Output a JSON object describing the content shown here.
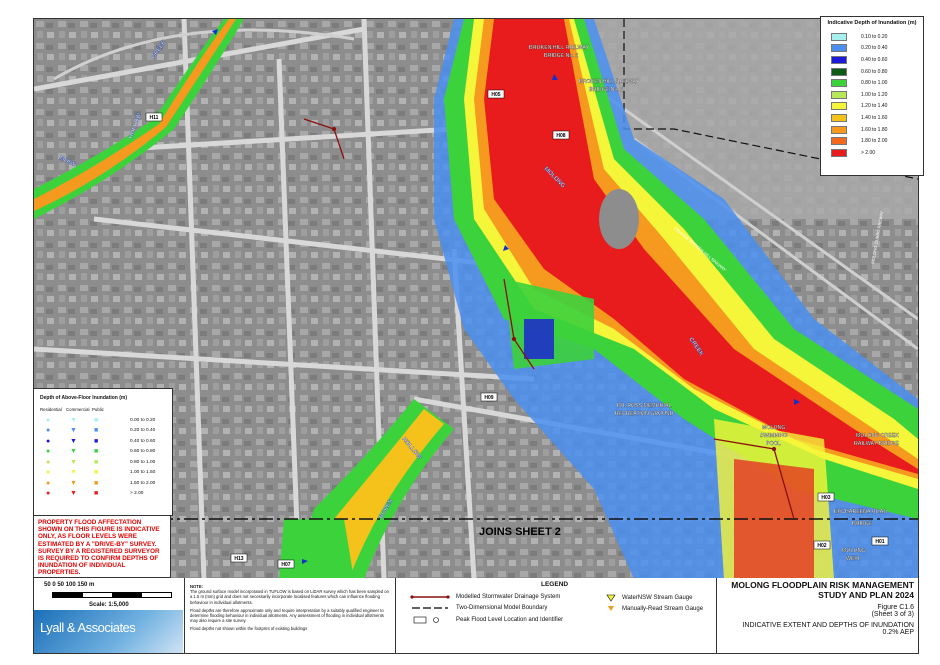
{
  "map": {
    "labels": {
      "broken_hill_2": "BROKEN HILL RAILWAY",
      "broken_hill_2b": "BRIDGE No. 2",
      "broken_hill_1": "BROKEN HILL RAILWAY",
      "broken_hill_1b": "BRIDGE No. 1",
      "molong_creek_n": "MOLONG",
      "creek_label": "CREEK",
      "creek_nw": "CREEK",
      "hollow_nw": "HOLLOW",
      "moss": "MOSS",
      "hollow_s": "HOLLOW",
      "bores": "BORES",
      "ross": "DR. ROSS MEMORIAL",
      "ross2": "RECREATION GROUND",
      "pool1": "MOLONG",
      "pool2": "SWIMMING",
      "pool3": "POOL",
      "mcr1": "MOLONG CREEK",
      "mcr2": "RAILWAY BRIDGE",
      "euch": "EUCHAREENA ROAD",
      "bridge": "BRIDGE",
      "weir1": "MOLONG",
      "weir2": "WEIR",
      "joins": "JOINS SHEET 2",
      "orange_rail": "ORANGE BROKEN HILL RAILWAY",
      "dubbo_rail": "MOLONG DUBBO RAILWAY",
      "h11": "H11",
      "h13": "H13",
      "h05": "H05",
      "h09": "H09",
      "h03": "H03",
      "h07": "H07",
      "h01": "H01",
      "h02": "H02",
      "h08": "H08"
    }
  },
  "depth_legend": {
    "title": "Indicative Depth of Inundation (m)",
    "rows": [
      {
        "label": "0.10 to 0.20",
        "color": "#a6f0f0"
      },
      {
        "label": "0.20 to 0.40",
        "color": "#4a8ff0"
      },
      {
        "label": "0.40 to 0.60",
        "color": "#1a1ad8"
      },
      {
        "label": "0.60 to 0.80",
        "color": "#0f5a14"
      },
      {
        "label": "0.80 to 1.00",
        "color": "#3cd23c"
      },
      {
        "label": "1.00 to 1.20",
        "color": "#b8e85a"
      },
      {
        "label": "1.20 to 1.40",
        "color": "#f5f53a"
      },
      {
        "label": "1.40 to 1.60",
        "color": "#f5c21c"
      },
      {
        "label": "1.60 to 1.80",
        "color": "#f59a1e"
      },
      {
        "label": "1.80 to 2.00",
        "color": "#f26a20"
      },
      {
        "label": "> 2.00",
        "color": "#e81c1c"
      }
    ]
  },
  "floor_legend": {
    "title": "Depth of Above-Floor Inundation (m)",
    "headers": [
      "Residential",
      "Commercial",
      "Public"
    ],
    "rows": [
      {
        "label": "0.00 to 0.20",
        "color": "#a6f0f0"
      },
      {
        "label": "0.20 to 0.40",
        "color": "#4a8ff0"
      },
      {
        "label": "0.40 to 0.60",
        "color": "#1a1ad8"
      },
      {
        "label": "0.60 to 0.80",
        "color": "#3cd23c"
      },
      {
        "label": "0.80 to 1.00",
        "color": "#b8e85a"
      },
      {
        "label": "1.00 to 1.50",
        "color": "#f5f53a"
      },
      {
        "label": "1.50 to 2.00",
        "color": "#f59a1e"
      },
      {
        "label": "> 2.00",
        "color": "#e81c1c"
      }
    ]
  },
  "warning": "PROPERTY FLOOD AFFECTATION SHOWN ON THIS FIGURE IS INDICATIVE ONLY, AS FLOOR LEVELS WERE ESTIMATED BY A \"DRIVE-BY\" SURVEY. SURVEY BY A REGISTERED SURVEYOR IS REQUIRED TO CONFIRM DEPTHS OF INUNDATION OF INDIVIDUAL PROPERTIES.",
  "scale": {
    "ticks": "50    0    50    100    150 m",
    "caption": "Scale: 1:5,000",
    "logo": "Lyall & Associates"
  },
  "note": {
    "title": "NOTE:",
    "p1": "The ground surface model incorporated in TUFLOW is based on LiDAR survey which has been sampled on a 1.5 m (mm) grid and does not necessarily incorporate localised features which can influence flooding behaviour in individual allotments.",
    "p2": "Flood depths are therefore approximate only and require interpretation by a suitably qualified engineer to determine flooding behaviour in individual allotments. Any assessment of flooding in individual allotments may also require a site survey.",
    "p3": "Flood depths not shown within the footprint of existing buildings"
  },
  "legend": {
    "title": "LEGEND",
    "drainage": "Modelled Stormwater Drainage System",
    "boundary": "Two-Dimensional Model Boundary",
    "peak": "Peak Flood Level Location and Identifier",
    "water_nsw": "WaterNSW Stream Gauge",
    "manual": "Manually-Read Stream Gauge",
    "peak_id": "H00"
  },
  "title_block": {
    "line1": "MOLONG FLOODPLAIN RISK MANAGEMENT",
    "line2": "STUDY AND PLAN 2024",
    "figure": "Figure C1.6",
    "sheet": "(Sheet 3 of 3)",
    "desc": "INDICATIVE EXTENT AND DEPTHS OF INUNDATION",
    "aep": "0.2% AEP"
  }
}
